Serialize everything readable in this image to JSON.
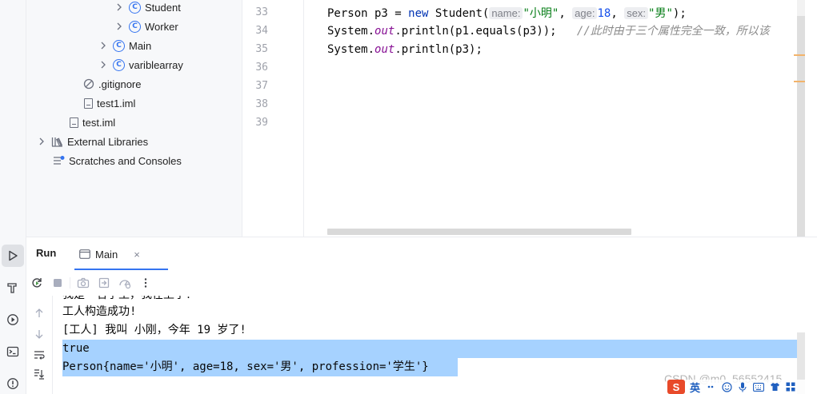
{
  "project_tree": {
    "items": [
      {
        "label": "Student",
        "kind": "class-icon",
        "expandable": true
      },
      {
        "label": "Worker",
        "kind": "class-icon",
        "expandable": true
      },
      {
        "label": "Main",
        "kind": "class-icon",
        "expandable": true
      },
      {
        "label": "variblearray",
        "kind": "class-icon",
        "expandable": true
      },
      {
        "label": ".gitignore",
        "kind": "ignored-file-icon",
        "expandable": false
      },
      {
        "label": "test1.iml",
        "kind": "file-icon",
        "expandable": false
      },
      {
        "label": "test.iml",
        "kind": "file-icon",
        "expandable": false
      },
      {
        "label": "External Libraries",
        "kind": "library-icon",
        "expandable": true
      },
      {
        "label": "Scratches and Consoles",
        "kind": "scratches-icon",
        "expandable": false
      }
    ]
  },
  "editor": {
    "line_numbers": [
      "33",
      "34",
      "35",
      "36",
      "37",
      "38",
      "39"
    ],
    "line33": {
      "type": "Person",
      "var": " p3 = ",
      "kw_new": "new",
      "ctor": " Student(",
      "hint_name": "name:",
      "arg_name": "\"小明\"",
      "sep1": ", ",
      "hint_age": "age:",
      "arg_age": "18",
      "sep2": ", ",
      "hint_sex": "sex:",
      "arg_sex": "\"男\"",
      "end": ");"
    },
    "line34": {
      "pre": "System.",
      "field": "out",
      "post": ".println(p1.equals(p3));   ",
      "comment": "//此时由于三个属性完全一致，所以该"
    },
    "line35": {
      "pre": "System.",
      "field": "out",
      "post": ".println(p3);"
    }
  },
  "run_panel": {
    "title": "Run",
    "tab_label": "Main",
    "close_glyph": "×",
    "console_lines": [
      "我是一名学生，我在上学！",
      "工人构造成功!",
      "[工人] 我叫 小刚，今年 19 岁了!",
      "true",
      "Person{name='小明', age=18, sex='男', profession='学生'}"
    ]
  },
  "watermark": "CSDN @m0_56552415",
  "ime": {
    "logo": "S",
    "mode": "英"
  },
  "colors": {
    "accent": "#3574f0",
    "selection": "#a6d2ff",
    "keyword": "#0033b3",
    "string": "#067d17",
    "number": "#1750eb",
    "static_field": "#871094",
    "comment": "#8c8c8c"
  }
}
